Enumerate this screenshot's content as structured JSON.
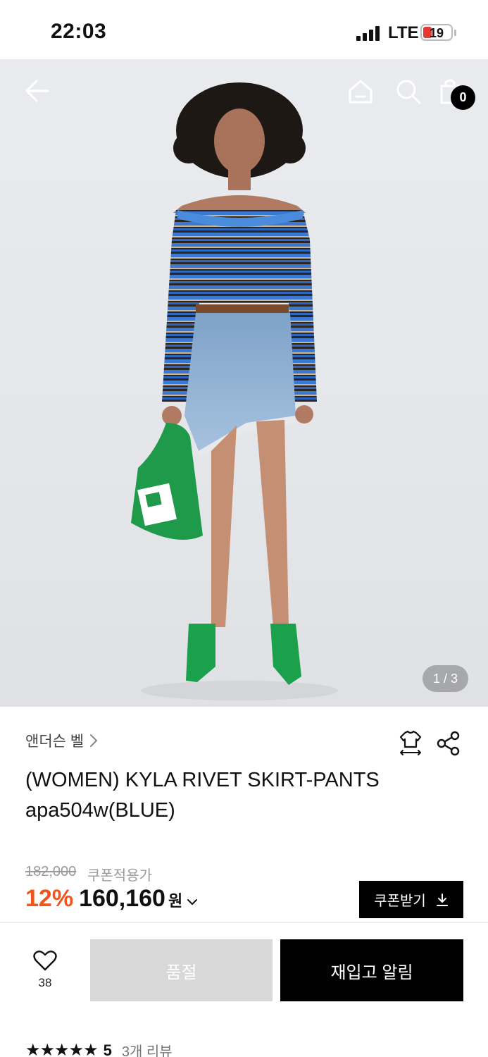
{
  "status_bar": {
    "time": "22:03",
    "network": "LTE",
    "battery": "19"
  },
  "header": {
    "cart_count": "0"
  },
  "gallery": {
    "page_indicator": "1 / 3"
  },
  "product": {
    "brand": "앤더슨 벨",
    "title": "(WOMEN) KYLA RIVET SKIRT-PANTS apa504w(BLUE)",
    "original_price": "182,000",
    "coupon_note": "쿠폰적용가",
    "discount": "12%",
    "price": "160,160",
    "currency": "원"
  },
  "coupon_button": {
    "label": "쿠폰받기"
  },
  "action_bar": {
    "like_count": "38",
    "soldout_label": "품절",
    "restock_label": "재입고 알림"
  },
  "rating": {
    "stars": "★★★★★",
    "score": "5",
    "review_count": "3개 리뷰"
  },
  "colors": {
    "accent": "#f2541b",
    "primary_button": "#000000",
    "disabled_button": "#d8d8d8"
  }
}
